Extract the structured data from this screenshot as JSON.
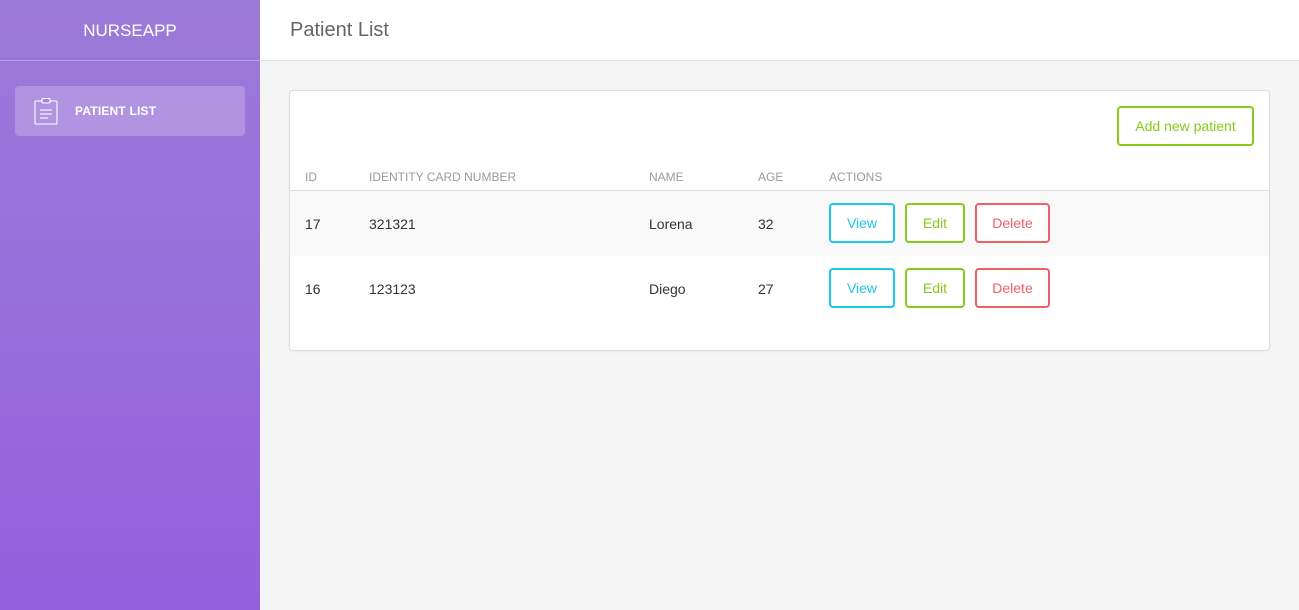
{
  "app": {
    "brand": "NURSEAPP"
  },
  "sidebar": {
    "items": [
      {
        "label": "PATIENT LIST",
        "icon": "clipboard-icon",
        "active": true
      }
    ]
  },
  "header": {
    "title": "Patient List"
  },
  "toolbar": {
    "add_label": "Add new patient"
  },
  "table": {
    "columns": [
      "ID",
      "IDENTITY CARD NUMBER",
      "NAME",
      "AGE",
      "ACTIONS"
    ],
    "rows": [
      {
        "id": "17",
        "identity_card_number": "321321",
        "name": "Lorena",
        "age": "32"
      },
      {
        "id": "16",
        "identity_card_number": "123123",
        "name": "Diego",
        "age": "27"
      }
    ],
    "actions": {
      "view": "View",
      "edit": "Edit",
      "delete": "Delete"
    }
  },
  "colors": {
    "sidebar_top": "#9b7bd9",
    "sidebar_bottom": "#9560dc",
    "success": "#87cb16",
    "info": "#1dc7ea",
    "danger": "#ef5f68"
  }
}
